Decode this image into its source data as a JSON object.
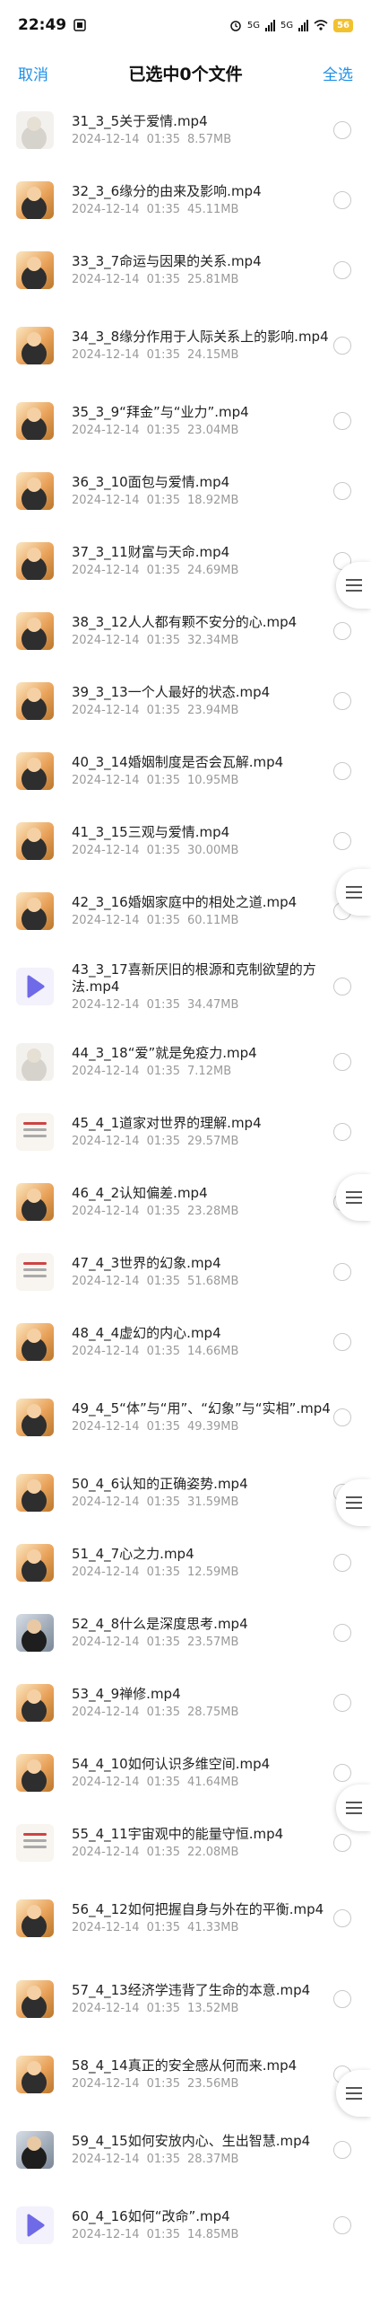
{
  "status_bar": {
    "time": "22:49",
    "network_1": "5G",
    "network_2": "5G",
    "battery": "56"
  },
  "header": {
    "cancel": "取消",
    "title": "已选中0个文件",
    "select_all": "全选"
  },
  "files": [
    {
      "name": "31_3_5关于爱情.mp4",
      "date": "2024-12-14",
      "time": "01:35",
      "size": "8.57MB",
      "thumb": "light"
    },
    {
      "name": "32_3_6缘分的由来及影响.mp4",
      "date": "2024-12-14",
      "time": "01:35",
      "size": "45.11MB",
      "thumb": "person"
    },
    {
      "name": "33_3_7命运与因果的关系.mp4",
      "date": "2024-12-14",
      "time": "01:35",
      "size": "25.81MB",
      "thumb": "person"
    },
    {
      "name": "34_3_8缘分作用于人际关系上的影响.mp4",
      "date": "2024-12-14",
      "time": "01:35",
      "size": "24.15MB",
      "thumb": "person"
    },
    {
      "name": "35_3_9“拜金”与“业力”.mp4",
      "date": "2024-12-14",
      "time": "01:35",
      "size": "23.04MB",
      "thumb": "person"
    },
    {
      "name": "36_3_10面包与爱情.mp4",
      "date": "2024-12-14",
      "time": "01:35",
      "size": "18.92MB",
      "thumb": "person"
    },
    {
      "name": "37_3_11财富与天命.mp4",
      "date": "2024-12-14",
      "time": "01:35",
      "size": "24.69MB",
      "thumb": "person"
    },
    {
      "name": "38_3_12人人都有颗不安分的心.mp4",
      "date": "2024-12-14",
      "time": "01:35",
      "size": "32.34MB",
      "thumb": "person"
    },
    {
      "name": "39_3_13一个人最好的状态.mp4",
      "date": "2024-12-14",
      "time": "01:35",
      "size": "23.94MB",
      "thumb": "person"
    },
    {
      "name": "40_3_14婚姻制度是否会瓦解.mp4",
      "date": "2024-12-14",
      "time": "01:35",
      "size": "10.95MB",
      "thumb": "person"
    },
    {
      "name": "41_3_15三观与爱情.mp4",
      "date": "2024-12-14",
      "time": "01:35",
      "size": "30.00MB",
      "thumb": "person"
    },
    {
      "name": "42_3_16婚姻家庭中的相处之道.mp4",
      "date": "2024-12-14",
      "time": "01:35",
      "size": "60.11MB",
      "thumb": "person"
    },
    {
      "name": "43_3_17喜新厌旧的根源和克制欲望的方法.mp4",
      "date": "2024-12-14",
      "time": "01:35",
      "size": "34.47MB",
      "thumb": "video"
    },
    {
      "name": "44_3_18“爱”就是免疫力.mp4",
      "date": "2024-12-14",
      "time": "01:35",
      "size": "7.12MB",
      "thumb": "light"
    },
    {
      "name": "45_4_1道家对世界的理解.mp4",
      "date": "2024-12-14",
      "time": "01:35",
      "size": "29.57MB",
      "thumb": "doc"
    },
    {
      "name": "46_4_2认知偏差.mp4",
      "date": "2024-12-14",
      "time": "01:35",
      "size": "23.28MB",
      "thumb": "person"
    },
    {
      "name": "47_4_3世界的幻象.mp4",
      "date": "2024-12-14",
      "time": "01:35",
      "size": "51.68MB",
      "thumb": "doc"
    },
    {
      "name": "48_4_4虚幻的内心.mp4",
      "date": "2024-12-14",
      "time": "01:35",
      "size": "14.66MB",
      "thumb": "person"
    },
    {
      "name": "49_4_5“体”与“用”、“幻象”与“实相”.mp4",
      "date": "2024-12-14",
      "time": "01:35",
      "size": "49.39MB",
      "thumb": "person"
    },
    {
      "name": "50_4_6认知的正确姿势.mp4",
      "date": "2024-12-14",
      "time": "01:35",
      "size": "31.59MB",
      "thumb": "person"
    },
    {
      "name": "51_4_7心之力.mp4",
      "date": "2024-12-14",
      "time": "01:35",
      "size": "12.59MB",
      "thumb": "person"
    },
    {
      "name": "52_4_8什么是深度思考.mp4",
      "date": "2024-12-14",
      "time": "01:35",
      "size": "23.57MB",
      "thumb": "dark"
    },
    {
      "name": "53_4_9禅修.mp4",
      "date": "2024-12-14",
      "time": "01:35",
      "size": "28.75MB",
      "thumb": "person"
    },
    {
      "name": "54_4_10如何认识多维空间.mp4",
      "date": "2024-12-14",
      "time": "01:35",
      "size": "41.64MB",
      "thumb": "person"
    },
    {
      "name": "55_4_11宇宙观中的能量守恒.mp4",
      "date": "2024-12-14",
      "time": "01:35",
      "size": "22.08MB",
      "thumb": "doc"
    },
    {
      "name": "56_4_12如何把握自身与外在的平衡.mp4",
      "date": "2024-12-14",
      "time": "01:35",
      "size": "41.33MB",
      "thumb": "person"
    },
    {
      "name": "57_4_13经济学违背了生命的本意.mp4",
      "date": "2024-12-14",
      "time": "01:35",
      "size": "13.52MB",
      "thumb": "person"
    },
    {
      "name": "58_4_14真正的安全感从何而来.mp4",
      "date": "2024-12-14",
      "time": "01:35",
      "size": "23.56MB",
      "thumb": "person"
    },
    {
      "name": "59_4_15如何安放内心、生出智慧.mp4",
      "date": "2024-12-14",
      "time": "01:35",
      "size": "28.37MB",
      "thumb": "dark"
    },
    {
      "name": "60_4_16如何“改命”.mp4",
      "date": "2024-12-14",
      "time": "01:35",
      "size": "14.85MB",
      "thumb": "video"
    }
  ]
}
